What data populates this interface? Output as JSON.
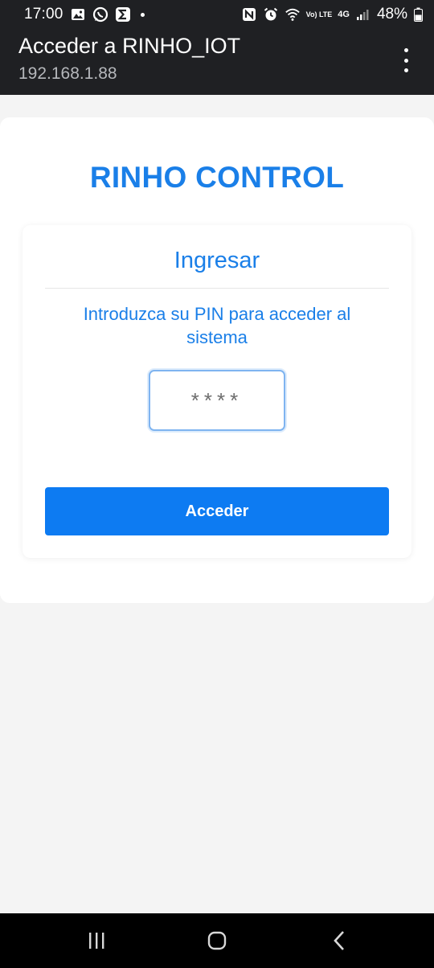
{
  "status_bar": {
    "time": "17:00",
    "battery": "48%",
    "network_label": "Vo) LTE",
    "network_gen": "4G",
    "icons": [
      "gallery-icon",
      "whatsapp-icon",
      "sigma-app-icon",
      "notification-dot-icon",
      "nfc-icon",
      "alarm-icon",
      "wifi-icon",
      "signal-icon",
      "battery-icon"
    ]
  },
  "app_bar": {
    "title": "Acceder a RINHO_IOT",
    "url": "192.168.1.88",
    "menu_icon": "more-vertical-icon"
  },
  "page": {
    "brand_title": "RINHO CONTROL",
    "login": {
      "heading": "Ingresar",
      "instruction": "Introduzca su PIN para acceder al sistema",
      "pin_placeholder": "****",
      "pin_value": "",
      "submit_label": "Acceder"
    }
  },
  "nav_bar": {
    "icons": [
      "recent-apps-icon",
      "home-icon",
      "back-icon"
    ]
  },
  "colors": {
    "accent": "#1a7fe8",
    "button": "#0d7bf2",
    "bars": "#1f2023",
    "background": "#f4f4f4"
  }
}
